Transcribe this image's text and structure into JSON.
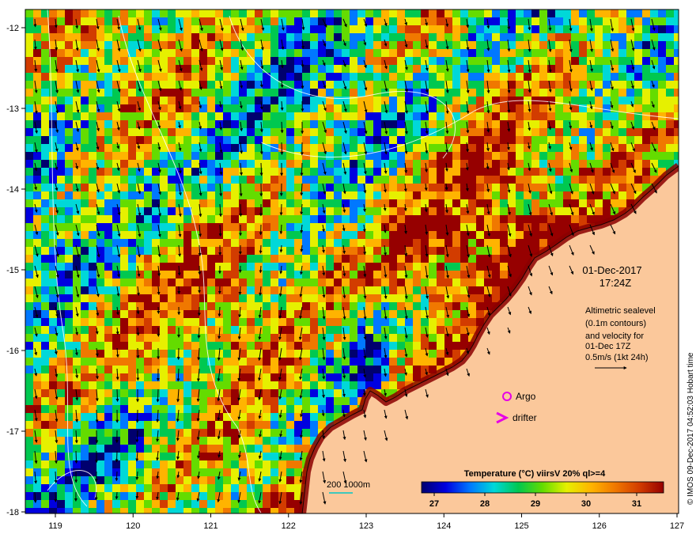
{
  "map": {
    "lon_ticks": [
      "119",
      "120",
      "121",
      "122",
      "123",
      "124",
      "125",
      "126",
      "127"
    ],
    "lat_ticks": [
      "-12",
      "-13",
      "-14",
      "-15",
      "-16",
      "-17",
      "-18"
    ]
  },
  "info": {
    "date": "01-Dec-2017",
    "time": "17:24Z",
    "alt_lines": [
      "Altimetric sealevel",
      "(0.1m contours)",
      "and velocity for",
      "01-Dec 17Z",
      "0.5m/s (1kt 24h)"
    ]
  },
  "legend": {
    "argo_label": "Argo",
    "drifter_label": "drifter",
    "bathy_label": "200  1000m",
    "colorbar_title": "Temperature (°C) viirsV 20% ql>=4",
    "colorbar_ticks": [
      "27",
      "28",
      "29",
      "30",
      "31"
    ],
    "colorbar_colors": [
      "#00006e",
      "#0000e0",
      "#0078ff",
      "#00d8d8",
      "#00c850",
      "#64dc00",
      "#e6f000",
      "#ffb400",
      "#f07800",
      "#d23c00",
      "#960000"
    ]
  },
  "credit": "© IMOS 09-Dec-2017 04:52:03 Hobart time",
  "colors": {
    "land": "#fbc89b",
    "coast": "#8b0000",
    "argo": "#e600e6",
    "bathy": "#00c8c8",
    "contour": "#ffffff"
  }
}
